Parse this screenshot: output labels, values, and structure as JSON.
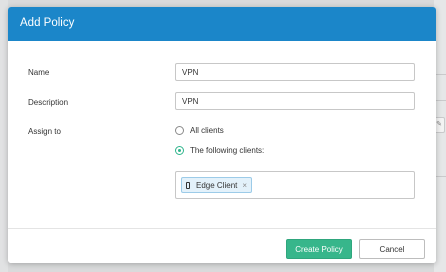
{
  "dialog": {
    "title": "Add Policy"
  },
  "form": {
    "name": {
      "label": "Name",
      "value": "VPN"
    },
    "description": {
      "label": "Description",
      "value": "VPN"
    },
    "assign_to": {
      "label": "Assign to",
      "options": [
        {
          "label": "All clients",
          "selected": false
        },
        {
          "label": "The following clients:",
          "selected": true
        }
      ],
      "clients": [
        {
          "label": "Edge Client",
          "icon": "mobile-device-icon",
          "remove": "×"
        }
      ]
    }
  },
  "footer": {
    "primary_label": "Create Policy",
    "cancel_label": "Cancel"
  },
  "colors": {
    "header": "#1b86c9",
    "primary_button": "#37b68b",
    "radio_checked": "#2fb58c"
  }
}
